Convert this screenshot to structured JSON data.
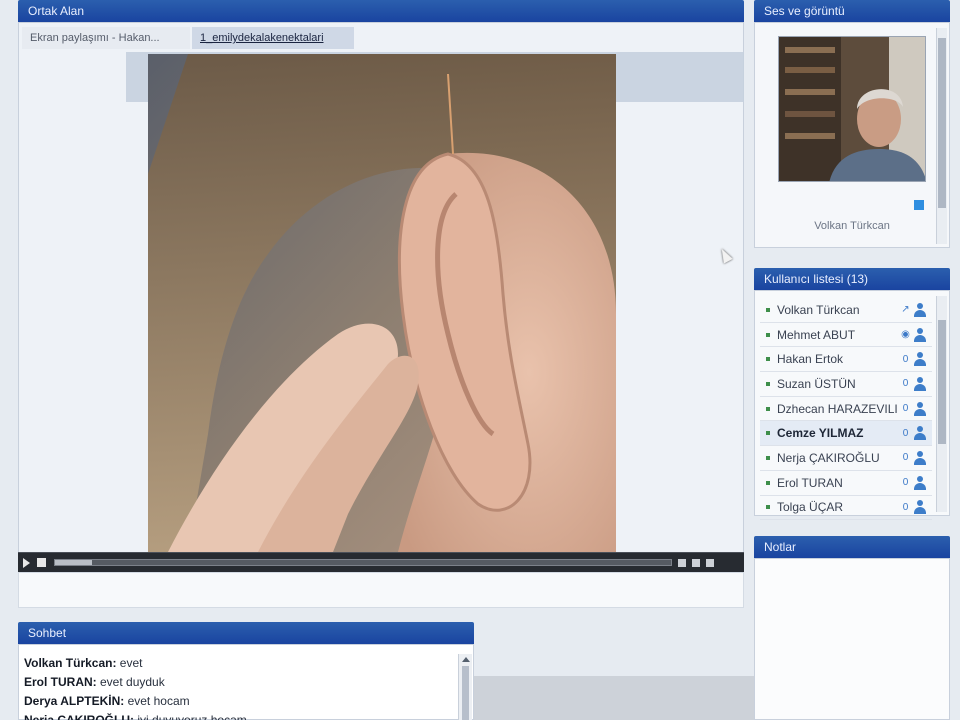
{
  "share_pod": {
    "title": "Ortak Alan",
    "tabs": [
      {
        "label": "Ekran paylaşımı - Hakan..."
      },
      {
        "label": "1_emilydekalakenektalari"
      }
    ],
    "video": {
      "progress": 0.06
    }
  },
  "camera_pod": {
    "title": "Ses ve görüntü",
    "presenter_name": "Volkan Türkcan"
  },
  "attendee_pod": {
    "title": "Kullanıcı listesi (13)",
    "users": [
      {
        "name": "Volkan Türkcan",
        "status": "mic",
        "selected": false
      },
      {
        "name": "Mehmet ABUT",
        "status": "pin",
        "selected": false
      },
      {
        "name": "Hakan Ertok",
        "status": "0",
        "selected": false
      },
      {
        "name": "Suzan ÜSTÜN",
        "status": "0",
        "selected": false
      },
      {
        "name": "Dzhecan HARAZEVILI",
        "status": "0",
        "selected": false
      },
      {
        "name": "Cemze YILMAZ",
        "status": "0",
        "selected": true
      },
      {
        "name": "Nerja ÇAKIROĞLU",
        "status": "0",
        "selected": false
      },
      {
        "name": "Erol TURAN",
        "status": "0",
        "selected": false
      },
      {
        "name": "Tolga ÜÇAR",
        "status": "0",
        "selected": false
      }
    ]
  },
  "notes_pod": {
    "title": "Notlar"
  },
  "chat_pod": {
    "title": "Sohbet",
    "messages": [
      {
        "sender": "Volkan Türkcan:",
        "text": " evet"
      },
      {
        "sender": "Erol TURAN:",
        "text": " evet duyduk"
      },
      {
        "sender": "Derya  ALPTEKİN:",
        "text": " evet hocam"
      },
      {
        "sender": "Nerja ÇAKIROĞLU:",
        "text": " iyi duyuyoruz hocam"
      }
    ]
  },
  "colors": {
    "header_blue": "#1a44a0",
    "role_icon_blue": "#3d7dc9",
    "active_dot_green": "#3e8e4a"
  }
}
